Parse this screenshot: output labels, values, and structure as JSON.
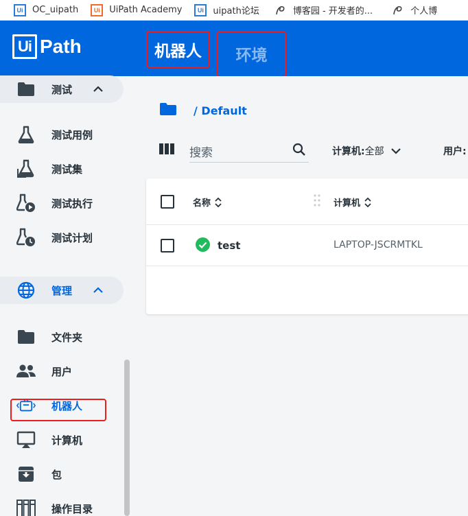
{
  "bookmarks": [
    {
      "label": "OC_uipath",
      "icon": "uipath-blue-favicon"
    },
    {
      "label": "UiPath Academy",
      "icon": "uipath-orange-favicon"
    },
    {
      "label": "uipath论坛",
      "icon": "uipath-blue-favicon"
    },
    {
      "label": "博客园 - 开发者的...",
      "icon": "cnblogs-favicon"
    },
    {
      "label": "个人博",
      "icon": "cnblogs-favicon"
    }
  ],
  "header": {
    "logo_box": "Ui",
    "logo_text": "Path",
    "tabs": [
      {
        "label": "机器人",
        "active": true
      },
      {
        "label": "环境",
        "active": false
      }
    ],
    "bg_color": "#0067df"
  },
  "sidebar": {
    "groups": [
      {
        "label": "测试",
        "icon": "folder-icon",
        "expanded": true,
        "items": [
          {
            "label": "测试用例",
            "icon": "flask-icon"
          },
          {
            "label": "测试集",
            "icon": "flask-set-icon"
          },
          {
            "label": "测试执行",
            "icon": "flask-play-icon"
          },
          {
            "label": "测试计划",
            "icon": "flask-clock-icon"
          }
        ]
      },
      {
        "label": "管理",
        "icon": "globe-icon",
        "expanded": true,
        "items": [
          {
            "label": "文件夹",
            "icon": "folder-icon"
          },
          {
            "label": "用户",
            "icon": "users-icon"
          },
          {
            "label": "机器人",
            "icon": "robot-icon",
            "active": true
          },
          {
            "label": "计算机",
            "icon": "monitor-icon"
          },
          {
            "label": "包",
            "icon": "package-icon"
          },
          {
            "label": "操作目录",
            "icon": "catalog-icon"
          }
        ]
      }
    ]
  },
  "main": {
    "breadcrumb": "/ Default",
    "search": {
      "placeholder": "搜索"
    },
    "filters": [
      {
        "label": "计算机:",
        "value": " 全部"
      },
      {
        "label": "用户:"
      }
    ],
    "table": {
      "columns": [
        "名称",
        "计算机"
      ],
      "rows": [
        {
          "name": "test",
          "machine": "LAPTOP-JSCRMTKL",
          "status": "ok"
        }
      ]
    }
  },
  "colors": {
    "accent": "#0067df",
    "highlight_box": "#ee1c1c",
    "status_ok": "#1fbb5c"
  }
}
